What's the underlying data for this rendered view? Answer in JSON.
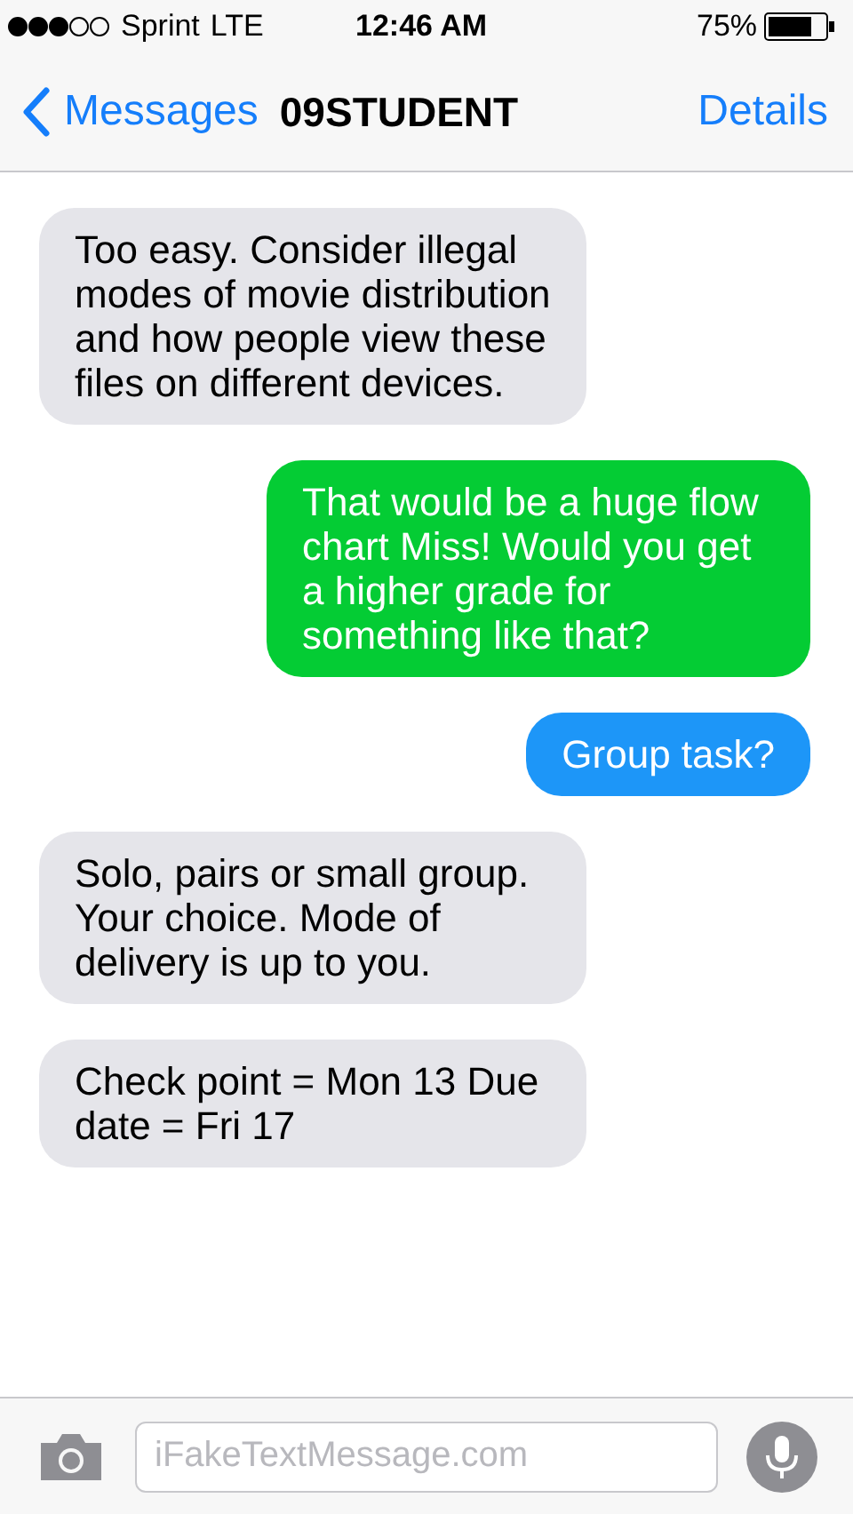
{
  "status_bar": {
    "carrier": "Sprint",
    "network": "LTE",
    "time": "12:46 AM",
    "battery": "75%"
  },
  "nav": {
    "back": "Messages",
    "title": "09STUDENT",
    "action": "Details"
  },
  "messages": [
    {
      "kind": "received",
      "text": "Too easy. Consider illegal modes of movie distribution and how people view these files on different devices."
    },
    {
      "kind": "sent_sms",
      "text": "That would be a huge flow chart Miss! Would you get a higher grade for something like that?"
    },
    {
      "kind": "sent_imessage",
      "text": "Group task?"
    },
    {
      "kind": "received",
      "text": "Solo, pairs or small group. Your choice. Mode of delivery is up to you."
    },
    {
      "kind": "received",
      "text": "Check point = Mon 13 Due date = Fri 17"
    }
  ],
  "composer": {
    "placeholder": "iFakeTextMessage.com"
  }
}
